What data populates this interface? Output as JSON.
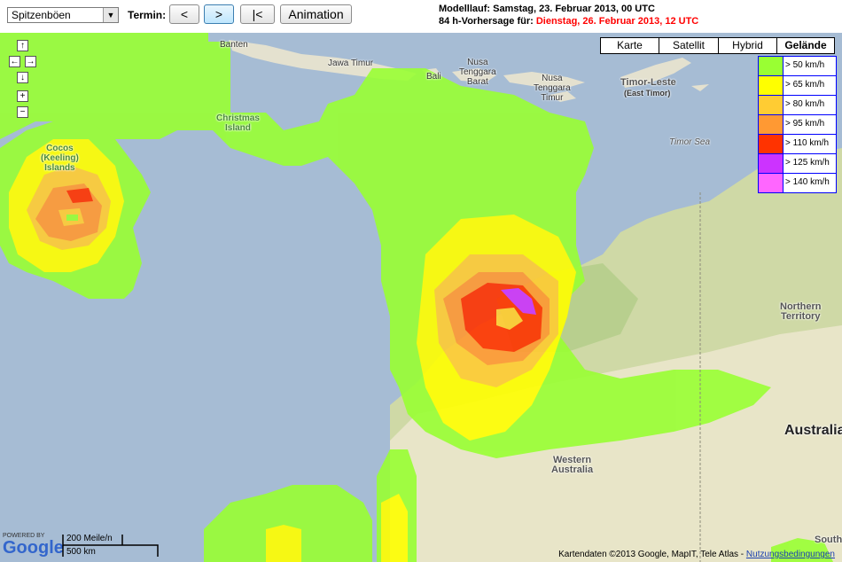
{
  "toolbar": {
    "select_value": "Spitzenböen",
    "termin_label": "Termin:",
    "prev_label": "<",
    "next_label": ">",
    "first_label": "|<",
    "animation_label": "Animation"
  },
  "run_info": {
    "model_run": "Modelllauf: Samstag, 23. Februar 2013, 00 UTC",
    "forecast_prefix": "84 h-Vorhersage für: ",
    "forecast_date": "Dienstag, 26. Februar 2013, 12 UTC"
  },
  "map_types": [
    "Karte",
    "Satellit",
    "Hybrid",
    "Gelände"
  ],
  "map_type_selected": "Gelände",
  "legend": [
    {
      "label": "> 50 km/h",
      "color": "#99ff33"
    },
    {
      "label": "> 65 km/h",
      "color": "#ffff00"
    },
    {
      "label": "> 80 km/h",
      "color": "#ffcc33"
    },
    {
      "label": "> 95 km/h",
      "color": "#ff9933"
    },
    {
      "label": "> 110 km/h",
      "color": "#ff3300"
    },
    {
      "label": "> 125 km/h",
      "color": "#cc33ff"
    },
    {
      "label": "> 140 km/h",
      "color": "#ff66ff"
    }
  ],
  "places": {
    "banten": "Banten",
    "jawa_timur": "Jawa Timur",
    "bali": "Bali",
    "ntb": "Nusa\nTenggara\nBarat",
    "ntt": "Nusa\nTenggara\nTimur",
    "timor_leste": "Timor-Leste",
    "east_timor": "(East Timor)",
    "timor_sea": "Timor Sea",
    "christmas": "Christmas\nIsland",
    "cocos": "Cocos\n(Keeling)\nIslands",
    "northern_territory": "Northern\nTerritory",
    "australia": "Australia",
    "western_australia": "Western\nAustralia",
    "south": "South"
  },
  "footer": {
    "powered_by": "POWERED BY",
    "google": "Google",
    "scale_mi": "200 Meile/n",
    "scale_km": "500 km",
    "attribution": "Kartendaten ©2013 Google, MapIT, Tele Atlas - ",
    "terms_link": "Nutzungsbedingungen"
  }
}
